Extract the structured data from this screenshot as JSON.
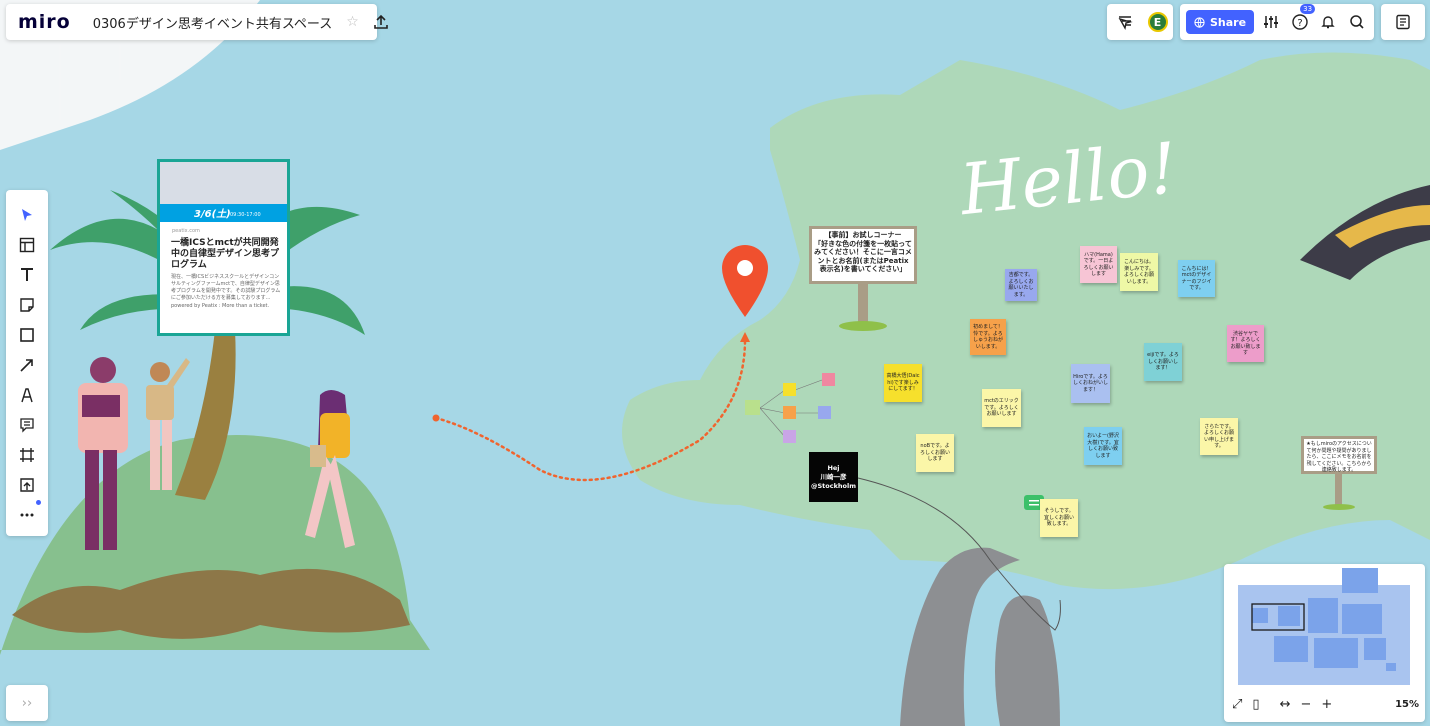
{
  "header": {
    "logo": "miro",
    "board_title": "0306デザイン思考イベント共有スペース"
  },
  "collab": {
    "avatar_initial": "E"
  },
  "actions": {
    "share_label": "Share",
    "help_badge": "33"
  },
  "minimap": {
    "zoom": "15%"
  },
  "webcard": {
    "date": "3/6(土)",
    "time": "09:30-17:00",
    "domain": "peatix.com",
    "title": "一橋ICSとmctが共同開発中の自律型デザイン思考プログラム",
    "description": "現在、一橋ICSビジネススクールとデザインコンサルティングファームmctで、自律型デザイン思考プログラムを開発中です。その試験プログラムにご参加いただける方を募集しております...",
    "powered": "powered by Peatix : More than a ticket."
  },
  "hello_text": "Hello!",
  "sign_main": "【事前】お試しコーナー\n「好きな色の付箋を一枚貼ってみてください！そこに一言コメントとお名前(またはPeatix表示名)を書いてください」",
  "sign_right": "★もしmiroのアクセスについて何か問題や疑問がありましたら、ここにメモをお名前を残してください。こちらから連絡致します。",
  "black_card": "Hej\n川崎一彦\n@Stockholm",
  "stickies": [
    {
      "id": "s1",
      "text": "ハマ(Hama)です。一日よろしくお願いします",
      "color": "#f7c5d5"
    },
    {
      "id": "s2",
      "text": "こんにちは。楽しみです。よろしくお願いします。",
      "color": "#eef8a6"
    },
    {
      "id": "s3",
      "text": "こんちには！mctのデザイナーのフジイです。",
      "color": "#7ecff0"
    },
    {
      "id": "s4",
      "text": "吉都です。よろしくお願いいたします。",
      "color": "#98a8ee"
    },
    {
      "id": "s5",
      "text": "初めまして！怜です。よろしゅうおねがいします。",
      "color": "#f6a14a"
    },
    {
      "id": "s6",
      "text": "eijiです。よろしくお願いします！",
      "color": "#7fd1d6"
    },
    {
      "id": "s7",
      "text": "渋谷ヤヤです！よろしくお願い致します",
      "color": "#ed9dca"
    },
    {
      "id": "s8",
      "text": "Hiroです。よろしくおねがいします！",
      "color": "#aac0f0"
    },
    {
      "id": "s9",
      "text": "高橋大悟(Daichi)です楽しみにしてます！",
      "color": "#f6e02c"
    },
    {
      "id": "s10",
      "text": "mctのエリックです。よろしくお願いします",
      "color": "#fbf6a8"
    },
    {
      "id": "s11",
      "text": "noBです。よろしくお願いします",
      "color": "#fbf6a8"
    },
    {
      "id": "s12",
      "text": "おいよー(野沢大樹)です。宜しくお願い致します",
      "color": "#7ecff0"
    },
    {
      "id": "s13",
      "text": "さらたです。よろしくお願い申し上げます。",
      "color": "#fbf6a8"
    },
    {
      "id": "s14",
      "text": "そうしです。宜しくお願い致します。",
      "color": "#fbf6a8"
    }
  ]
}
